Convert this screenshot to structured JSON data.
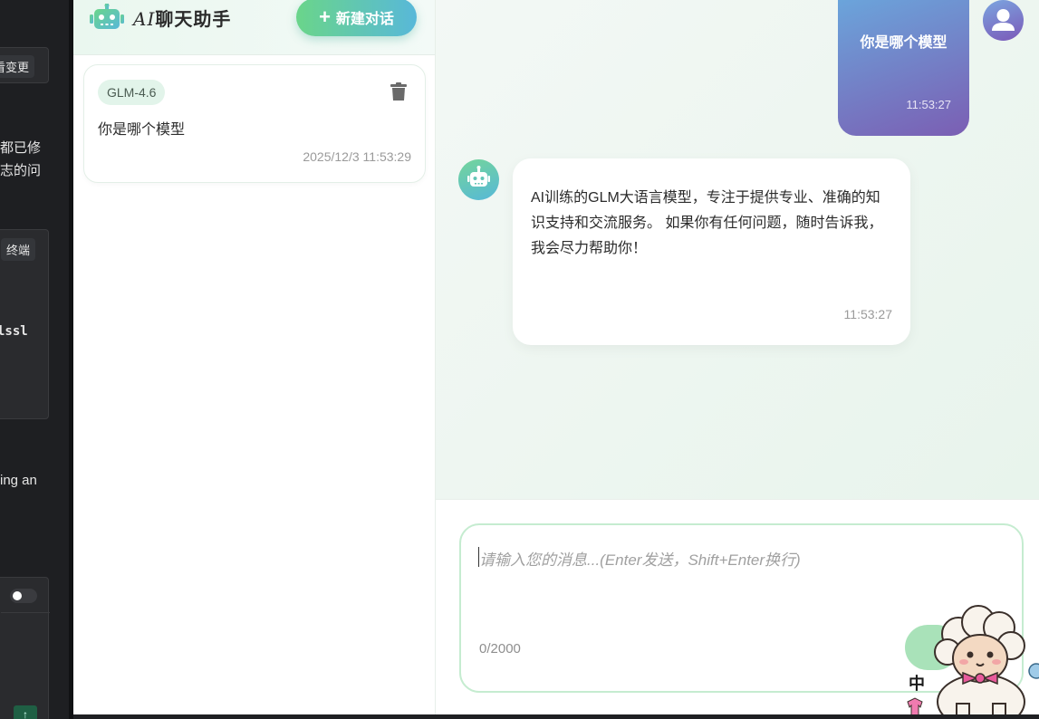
{
  "background_editor": {
    "tag_changes": "看变更",
    "text_line1": "都已修",
    "text_line2": "志的问",
    "tag_terminal": "终端",
    "code": "lssl",
    "text_line3": "ing an"
  },
  "sidebar": {
    "app_title_prefix": "AI",
    "app_title": "聊天助手",
    "new_chat_label": "新建对话",
    "conversations": [
      {
        "model": "GLM-4.6",
        "title": "你是哪个模型",
        "time": "2025/12/3 11:53:29"
      }
    ]
  },
  "chat": {
    "messages": [
      {
        "role": "user",
        "text": "你是哪个模型",
        "time": "11:53:27"
      },
      {
        "role": "assistant",
        "text": "AI训练的GLM大语言模型，专注于提供专业、准确的知识支持和交流服务。 如果你有任何问题，随时告诉我，我会尽力帮助你！",
        "time": "11:53:27"
      }
    ]
  },
  "input": {
    "placeholder": "请输入您的消息...(Enter发送，Shift+Enter换行)",
    "char_count": "0/2000"
  },
  "mascot": {
    "ime_label": "中"
  },
  "colors": {
    "accent_green": "#6ad58a",
    "accent_blue": "#58b8d9",
    "user_bubble_start": "#6aa8dd",
    "user_bubble_end": "#7b5eb3"
  }
}
